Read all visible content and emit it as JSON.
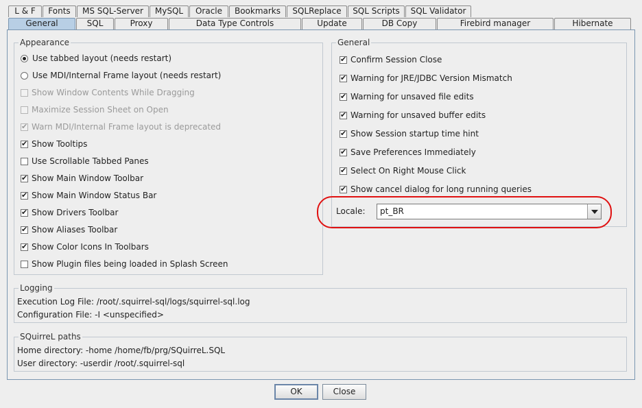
{
  "tabs_row1": [
    "L & F",
    "Fonts",
    "MS SQL-Server",
    "MySQL",
    "Oracle",
    "Bookmarks",
    "SQLReplace",
    "SQL Scripts",
    "SQL Validator"
  ],
  "tabs_row2": [
    "General",
    "SQL",
    "Proxy",
    "Data Type Controls",
    "Update",
    "DB Copy",
    "Firebird manager",
    "Hibernate"
  ],
  "appearance": {
    "title": "Appearance",
    "options": [
      {
        "label": "Use tabbed layout (needs restart)",
        "type": "radio",
        "checked": true,
        "enabled": true
      },
      {
        "label": "Use MDI/Internal Frame layout (needs restart)",
        "type": "radio",
        "checked": false,
        "enabled": true
      },
      {
        "label": "Show Window Contents While Dragging",
        "type": "checkbox",
        "checked": false,
        "enabled": false
      },
      {
        "label": "Maximize Session Sheet on Open",
        "type": "checkbox",
        "checked": false,
        "enabled": false
      },
      {
        "label": "Warn MDI/Internal Frame layout is deprecated",
        "type": "checkbox",
        "checked": true,
        "enabled": false
      },
      {
        "label": "Show Tooltips",
        "type": "checkbox",
        "checked": true,
        "enabled": true
      },
      {
        "label": "Use Scrollable Tabbed Panes",
        "type": "checkbox",
        "checked": false,
        "enabled": true
      },
      {
        "label": "Show Main Window Toolbar",
        "type": "checkbox",
        "checked": true,
        "enabled": true
      },
      {
        "label": "Show Main Window Status Bar",
        "type": "checkbox",
        "checked": true,
        "enabled": true
      },
      {
        "label": "Show Drivers Toolbar",
        "type": "checkbox",
        "checked": true,
        "enabled": true
      },
      {
        "label": "Show Aliases Toolbar",
        "type": "checkbox",
        "checked": true,
        "enabled": true
      },
      {
        "label": "Show Color Icons In Toolbars",
        "type": "checkbox",
        "checked": true,
        "enabled": true
      },
      {
        "label": "Show Plugin files being loaded in Splash Screen",
        "type": "checkbox",
        "checked": false,
        "enabled": true
      }
    ]
  },
  "general": {
    "title": "General",
    "options": [
      {
        "label": "Confirm Session Close",
        "checked": true
      },
      {
        "label": "Warning for JRE/JDBC Version Mismatch",
        "checked": true
      },
      {
        "label": "Warning for unsaved file edits",
        "checked": true
      },
      {
        "label": "Warning for unsaved buffer edits",
        "checked": true
      },
      {
        "label": "Show Session startup time hint",
        "checked": true
      },
      {
        "label": "Save Preferences Immediately",
        "checked": true
      },
      {
        "label": "Select On Right Mouse Click",
        "checked": true
      },
      {
        "label": "Show cancel dialog for long running queries",
        "checked": true
      }
    ],
    "locale_label": "Locale:",
    "locale_value": "pt_BR"
  },
  "logging": {
    "title": "Logging",
    "lines": [
      "Execution Log File: /root/.squirrel-sql/logs/squirrel-sql.log",
      "Configuration File: -I <unspecified>"
    ]
  },
  "paths": {
    "title": "SQuirreL paths",
    "lines": [
      "Home directory: -home /home/fb/prg/SQuirreL.SQL",
      "User directory: -userdir /root/.squirrel-sql"
    ]
  },
  "buttons": {
    "ok": "OK",
    "close": "Close"
  },
  "colors": {
    "highlight": "#e01010",
    "active_tab": "#b8cfe5"
  }
}
